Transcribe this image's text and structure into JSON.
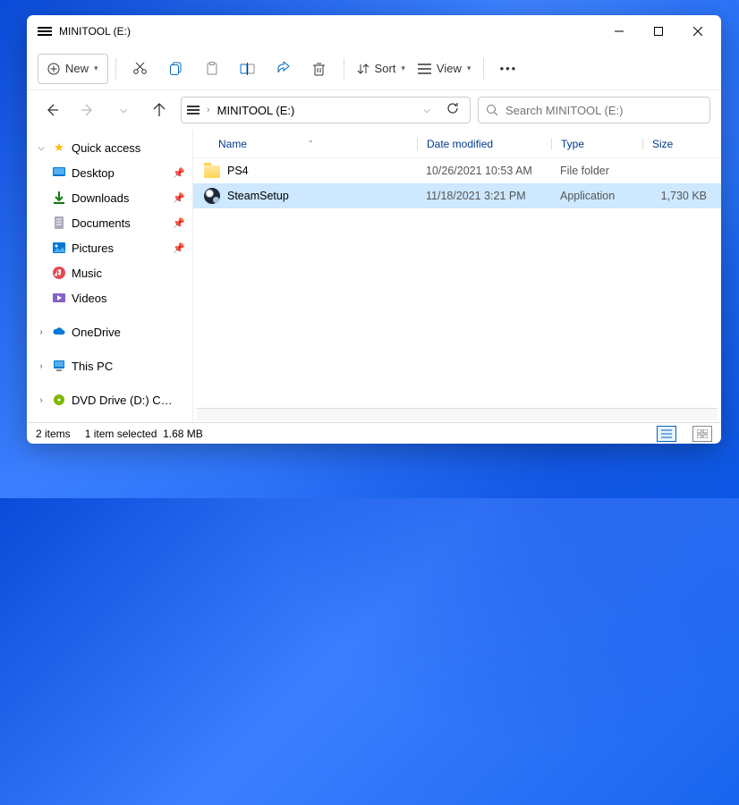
{
  "window": {
    "title": "MINITOOL (E:)"
  },
  "toolbar": {
    "new_label": "New",
    "sort_label": "Sort",
    "view_label": "View"
  },
  "address": {
    "path_text": "MINITOOL (E:)"
  },
  "search": {
    "placeholder": "Search MINITOOL (E:)"
  },
  "sidebar": {
    "quick_access": "Quick access",
    "items": [
      {
        "label": "Desktop",
        "pinned": true
      },
      {
        "label": "Downloads",
        "pinned": true
      },
      {
        "label": "Documents",
        "pinned": true
      },
      {
        "label": "Pictures",
        "pinned": true
      },
      {
        "label": "Music",
        "pinned": false
      },
      {
        "label": "Videos",
        "pinned": false
      }
    ],
    "onedrive": "OneDrive",
    "this_pc": "This PC",
    "dvd": "DVD Drive (D:) C…"
  },
  "columns": {
    "name": "Name",
    "date": "Date modified",
    "type": "Type",
    "size": "Size"
  },
  "rows": [
    {
      "name": "PS4",
      "date": "10/26/2021 10:53 AM",
      "type": "File folder",
      "size": "",
      "icon": "folder",
      "selected": false
    },
    {
      "name": "SteamSetup",
      "date": "11/18/2021 3:21 PM",
      "type": "Application",
      "size": "1,730 KB",
      "icon": "steam",
      "selected": true
    }
  ],
  "status": {
    "count": "2 items",
    "selection": "1 item selected",
    "size": "1.68 MB"
  }
}
